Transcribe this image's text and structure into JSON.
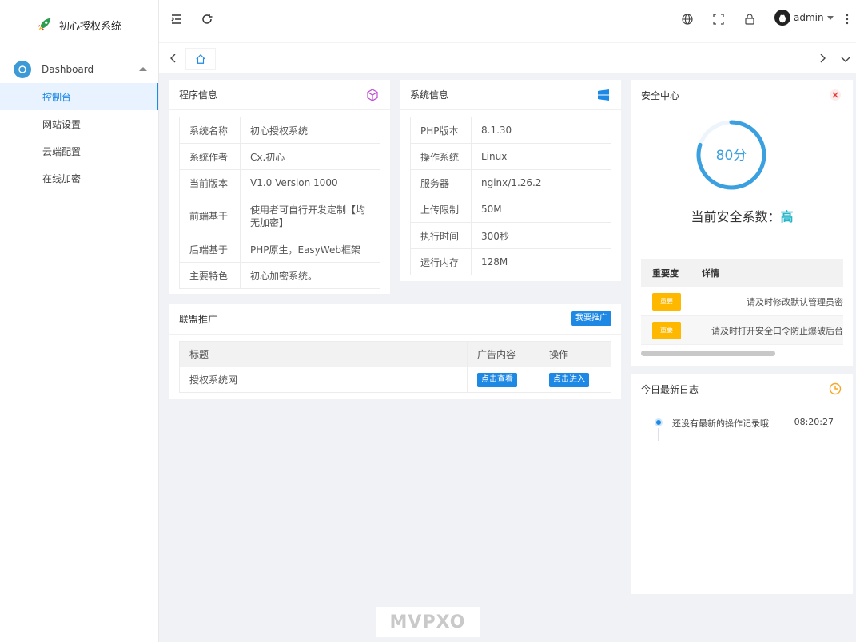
{
  "app": {
    "title": "初心授权系统"
  },
  "sidebar": {
    "group_label": "Dashboard",
    "items": [
      {
        "label": "控制台",
        "active": true
      },
      {
        "label": "网站设置",
        "active": false
      },
      {
        "label": "云端配置",
        "active": false
      },
      {
        "label": "在线加密",
        "active": false
      }
    ]
  },
  "header": {
    "user": "admin"
  },
  "program_info": {
    "title": "程序信息",
    "rows": [
      {
        "key": "系统名称",
        "value": "初心授权系统"
      },
      {
        "key": "系统作者",
        "value": "Cx.初心"
      },
      {
        "key": "当前版本",
        "value": "V1.0 Version 1000"
      },
      {
        "key": "前端基于",
        "value": "使用者可自行开发定制【均无加密】"
      },
      {
        "key": "后端基于",
        "value": "PHP原生，EasyWeb框架"
      },
      {
        "key": "主要特色",
        "value": "初心加密系统。"
      }
    ]
  },
  "system_info": {
    "title": "系统信息",
    "rows": [
      {
        "key": "PHP版本",
        "value": "8.1.30"
      },
      {
        "key": "操作系统",
        "value": "Linux"
      },
      {
        "key": "服务器",
        "value": "nginx/1.26.2"
      },
      {
        "key": "上传限制",
        "value": "50M"
      },
      {
        "key": "执行时间",
        "value": "300秒"
      },
      {
        "key": "运行内存",
        "value": "128M"
      }
    ]
  },
  "promo": {
    "title": "联盟推广",
    "button": "我要推广",
    "columns": [
      "标题",
      "广告内容",
      "操作"
    ],
    "rows": [
      {
        "title": "授权系统网",
        "view": "点击查看",
        "enter": "点击进入"
      }
    ]
  },
  "security": {
    "title": "安全中心",
    "score": "80分",
    "score_value": 80,
    "level_label": "当前安全系数：",
    "level": "高",
    "columns": [
      "重要度",
      "详情"
    ],
    "rows": [
      {
        "badge": "重要",
        "detail": "请及时修改默认管理员密"
      },
      {
        "badge": "重要",
        "detail": "请及时打开安全口令防止爆破后台"
      }
    ]
  },
  "logs": {
    "title": "今日最新日志",
    "entries": [
      {
        "text": "还没有最新的操作记录哦",
        "time": "08:20:27"
      }
    ]
  },
  "watermark": "MVPXO",
  "colors": {
    "accent": "#1e88e5",
    "warning": "#ffb800",
    "gauge": "#3aa0e0",
    "high": "#26b6c9"
  }
}
